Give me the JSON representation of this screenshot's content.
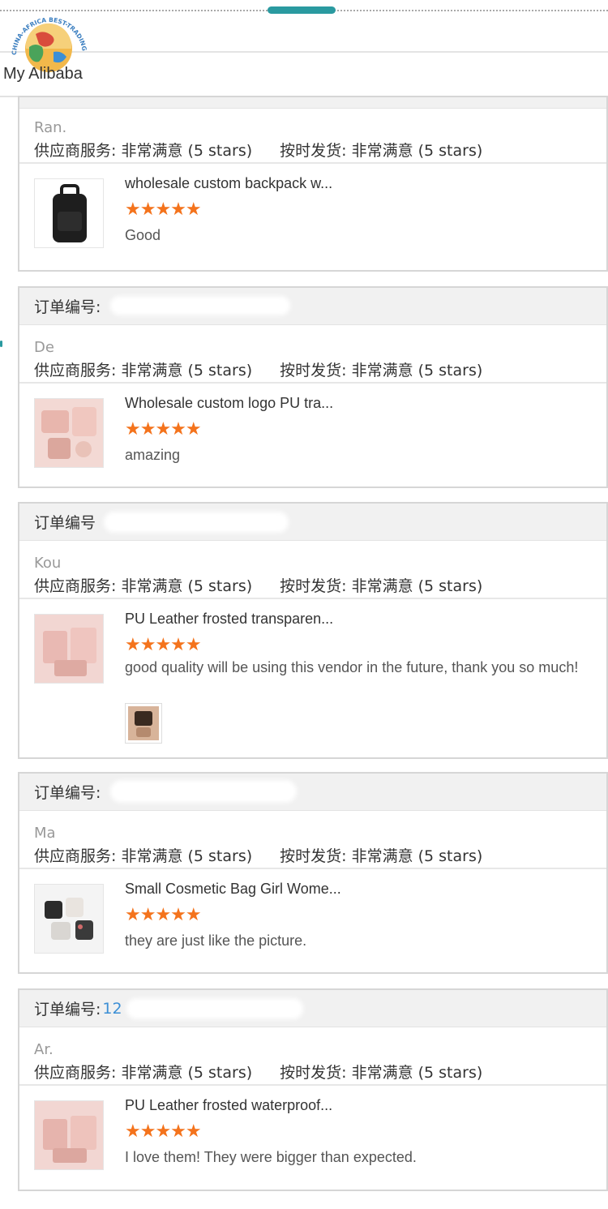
{
  "header": {
    "logo_ring_text": "CHINA-AFRICA BEST-TRADING PLATFORM",
    "logo_label": "My Alibaba"
  },
  "labels": {
    "order_no": "订单编号:",
    "order_no_nocolon": "订单编号",
    "supplier_service": "供应商服务: 非常满意 (5 stars)",
    "on_time_delivery": "按时发货: 非常满意 (5 stars)"
  },
  "colors": {
    "accent_teal": "#2a9aa0",
    "star_orange": "#f4731c",
    "order_link_blue": "#3c8fd5"
  },
  "reviews": [
    {
      "buyer": "Ran.",
      "product_title": "wholesale custom backpack w...",
      "stars": 5,
      "review": "Good",
      "thumb_icon": "black-backpack-icon"
    },
    {
      "buyer": "De",
      "product_title": "Wholesale custom logo PU tra...",
      "stars": 5,
      "review": "amazing",
      "thumb_icon": "pink-bags-icon"
    },
    {
      "buyer": "Kou",
      "product_title": "PU Leather frosted transparen...",
      "stars": 5,
      "review": "good quality        will be using this vendor in the future, thank you so much!",
      "thumb_icon": "pink-bag-set-icon"
    },
    {
      "buyer": "Ma",
      "product_title": "Small Cosmetic Bag Girl Wome...",
      "stars": 5,
      "review": "they are just like the picture.",
      "thumb_icon": "cosmetic-bags-icon"
    },
    {
      "order_visible": "12",
      "buyer": "Ar.",
      "product_title": "PU Leather frosted waterproof...",
      "stars": 5,
      "review": "I love them! They were bigger than expected.",
      "thumb_icon": "pink-bag-set-icon"
    }
  ],
  "star_glyphs": "★★★★★"
}
